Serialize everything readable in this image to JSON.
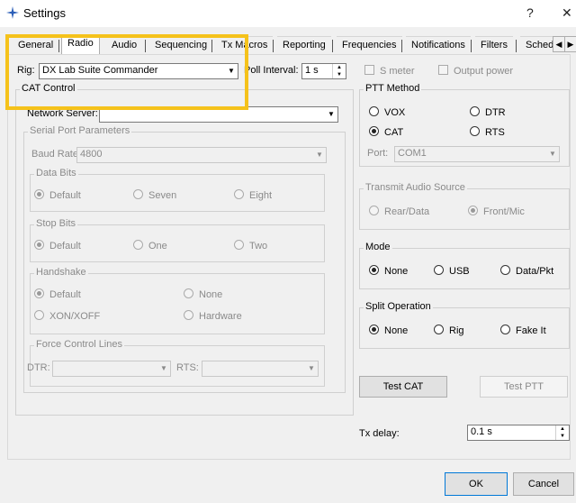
{
  "window": {
    "title": "Settings",
    "help_glyph": "?",
    "close_glyph": "✕"
  },
  "tabs": [
    "General",
    "Radio",
    "Audio",
    "Sequencing",
    "Tx Macros",
    "Reporting",
    "Frequencies",
    "Notifications",
    "Filters",
    "Schedu"
  ],
  "active_tab": "Radio",
  "rig": {
    "label": "Rig:",
    "value": "DX Lab Suite Commander"
  },
  "poll_interval": {
    "label": "Poll Interval:",
    "value": "1 s"
  },
  "s_meter": {
    "label": "S meter"
  },
  "output_power": {
    "label": "Output power"
  },
  "cat_control": {
    "title": "CAT Control",
    "network_server_label": "Network Server:",
    "network_server_value": "",
    "serial_port": {
      "title": "Serial Port Parameters",
      "baud_label": "Baud Rate:",
      "baud_value": "4800",
      "data_bits": {
        "title": "Data Bits",
        "options": [
          "Default",
          "Seven",
          "Eight"
        ]
      },
      "stop_bits": {
        "title": "Stop Bits",
        "options": [
          "Default",
          "One",
          "Two"
        ]
      },
      "handshake": {
        "title": "Handshake",
        "options": [
          "Default",
          "None",
          "XON/XOFF",
          "Hardware"
        ]
      },
      "force_lines": {
        "title": "Force Control Lines",
        "dtr_label": "DTR:",
        "rts_label": "RTS:"
      }
    }
  },
  "ptt": {
    "title": "PTT Method",
    "options": [
      "VOX",
      "DTR",
      "CAT",
      "RTS"
    ],
    "port_label": "Port:",
    "port_value": "COM1"
  },
  "tx_audio": {
    "title": "Transmit Audio Source",
    "options": [
      "Rear/Data",
      "Front/Mic"
    ]
  },
  "mode": {
    "title": "Mode",
    "options": [
      "None",
      "USB",
      "Data/Pkt"
    ]
  },
  "split": {
    "title": "Split Operation",
    "options": [
      "None",
      "Rig",
      "Fake It"
    ]
  },
  "test_cat": "Test CAT",
  "test_ptt": "Test PTT",
  "tx_delay": {
    "label": "Tx delay:",
    "value": "0.1 s"
  },
  "footer": {
    "ok": "OK",
    "cancel": "Cancel"
  },
  "colors": {
    "highlight": "#f5c21b",
    "accent": "#0078d7"
  }
}
